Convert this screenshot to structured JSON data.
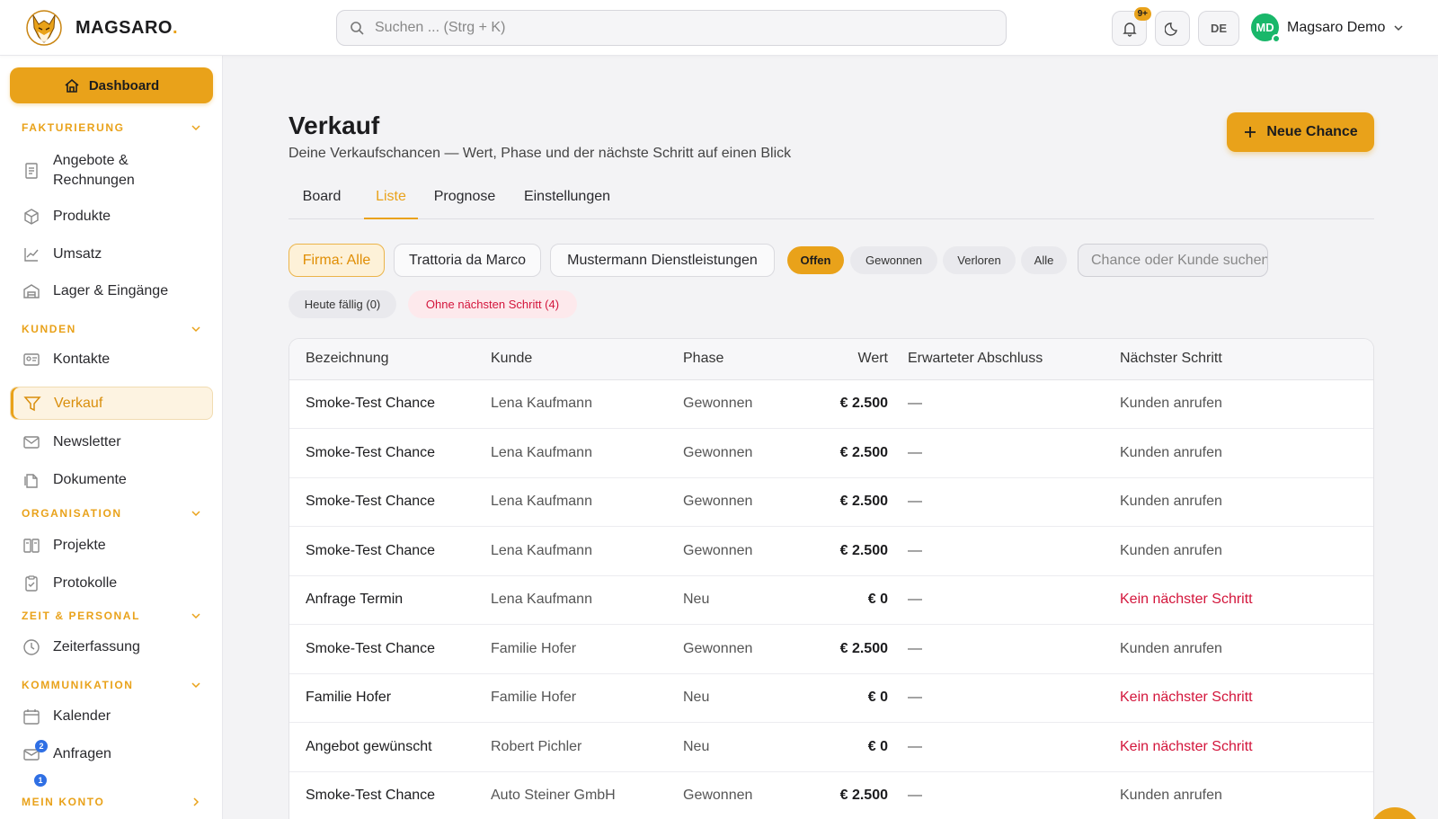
{
  "header": {
    "brand": "MAGSARO",
    "brand_dot": ".",
    "search_placeholder": "Suchen ... (Strg + K)",
    "notifications_badge": "9+",
    "language": "DE",
    "user_initials": "MD",
    "user_name": "Magsaro Demo"
  },
  "sidebar": {
    "dashboard_label": "Dashboard",
    "sections": [
      {
        "title": "FAKTURIERUNG",
        "items": [
          "Angebote &\nRechnungen",
          "Produkte",
          "Umsatz",
          "Lager & Eingänge"
        ]
      },
      {
        "title": "KUNDEN",
        "items": [
          "Kontakte",
          "Verkauf",
          "Newsletter",
          "Dokumente"
        ]
      },
      {
        "title": "ORGANISATION",
        "items": [
          "Projekte",
          "Protokolle"
        ]
      },
      {
        "title": "ZEIT & PERSONAL",
        "items": [
          "Zeiterfassung"
        ]
      },
      {
        "title": "KOMMUNIKATION",
        "items": [
          "Kalender",
          "Anfragen"
        ]
      },
      {
        "title": "MEIN KONTO",
        "items": []
      }
    ],
    "anfragen_badge": "2",
    "konto_badge": "1",
    "active_item": "Verkauf"
  },
  "page": {
    "title": "Verkauf",
    "subtitle": "Deine Verkaufschancen — Wert, Phase und der nächste Schritt auf einen Blick",
    "new_button": "Neue Chance",
    "tabs": [
      "Board",
      "Liste",
      "Prognose",
      "Einstellungen"
    ],
    "active_tab": "Liste"
  },
  "filters": {
    "companies": [
      "Firma: Alle",
      "Trattoria da Marco",
      "Mustermann Dienstleistungen"
    ],
    "status": [
      "Offen",
      "Gewonnen",
      "Verloren",
      "Alle"
    ],
    "search_placeholder": "Chance oder Kunde suchen",
    "due_today": "Heute fällig (0)",
    "no_next_step": "Ohne nächsten Schritt (4)"
  },
  "table": {
    "columns": [
      "Bezeichnung",
      "Kunde",
      "Phase",
      "Wert",
      "Erwarteter Abschluss",
      "Nächster Schritt"
    ],
    "rows": [
      {
        "name": "Smoke-Test Chance",
        "customer": "Lena Kaufmann",
        "phase": "Gewonnen",
        "value": "€ 2.500",
        "close": "—",
        "next": "Kunden anrufen",
        "warn": false
      },
      {
        "name": "Smoke-Test Chance",
        "customer": "Lena Kaufmann",
        "phase": "Gewonnen",
        "value": "€ 2.500",
        "close": "—",
        "next": "Kunden anrufen",
        "warn": false
      },
      {
        "name": "Smoke-Test Chance",
        "customer": "Lena Kaufmann",
        "phase": "Gewonnen",
        "value": "€ 2.500",
        "close": "—",
        "next": "Kunden anrufen",
        "warn": false
      },
      {
        "name": "Smoke-Test Chance",
        "customer": "Lena Kaufmann",
        "phase": "Gewonnen",
        "value": "€ 2.500",
        "close": "—",
        "next": "Kunden anrufen",
        "warn": false
      },
      {
        "name": "Anfrage Termin",
        "customer": "Lena Kaufmann",
        "phase": "Neu",
        "value": "€ 0",
        "close": "—",
        "next": "Kein nächster Schritt",
        "warn": true
      },
      {
        "name": "Smoke-Test Chance",
        "customer": "Familie Hofer",
        "phase": "Gewonnen",
        "value": "€ 2.500",
        "close": "—",
        "next": "Kunden anrufen",
        "warn": false
      },
      {
        "name": "Familie Hofer",
        "customer": "Familie Hofer",
        "phase": "Neu",
        "value": "€ 0",
        "close": "—",
        "next": "Kein nächster Schritt",
        "warn": true
      },
      {
        "name": "Angebot gewünscht",
        "customer": "Robert Pichler",
        "phase": "Neu",
        "value": "€ 0",
        "close": "—",
        "next": "Kein nächster Schritt",
        "warn": true
      },
      {
        "name": "Smoke-Test Chance",
        "customer": "Auto Steiner GmbH",
        "phase": "Gewonnen",
        "value": "€ 2.500",
        "close": "—",
        "next": "Kunden anrufen",
        "warn": false
      }
    ]
  },
  "colors": {
    "accent": "#e9a21a",
    "warn": "#d3153b",
    "online": "#19b76a"
  }
}
